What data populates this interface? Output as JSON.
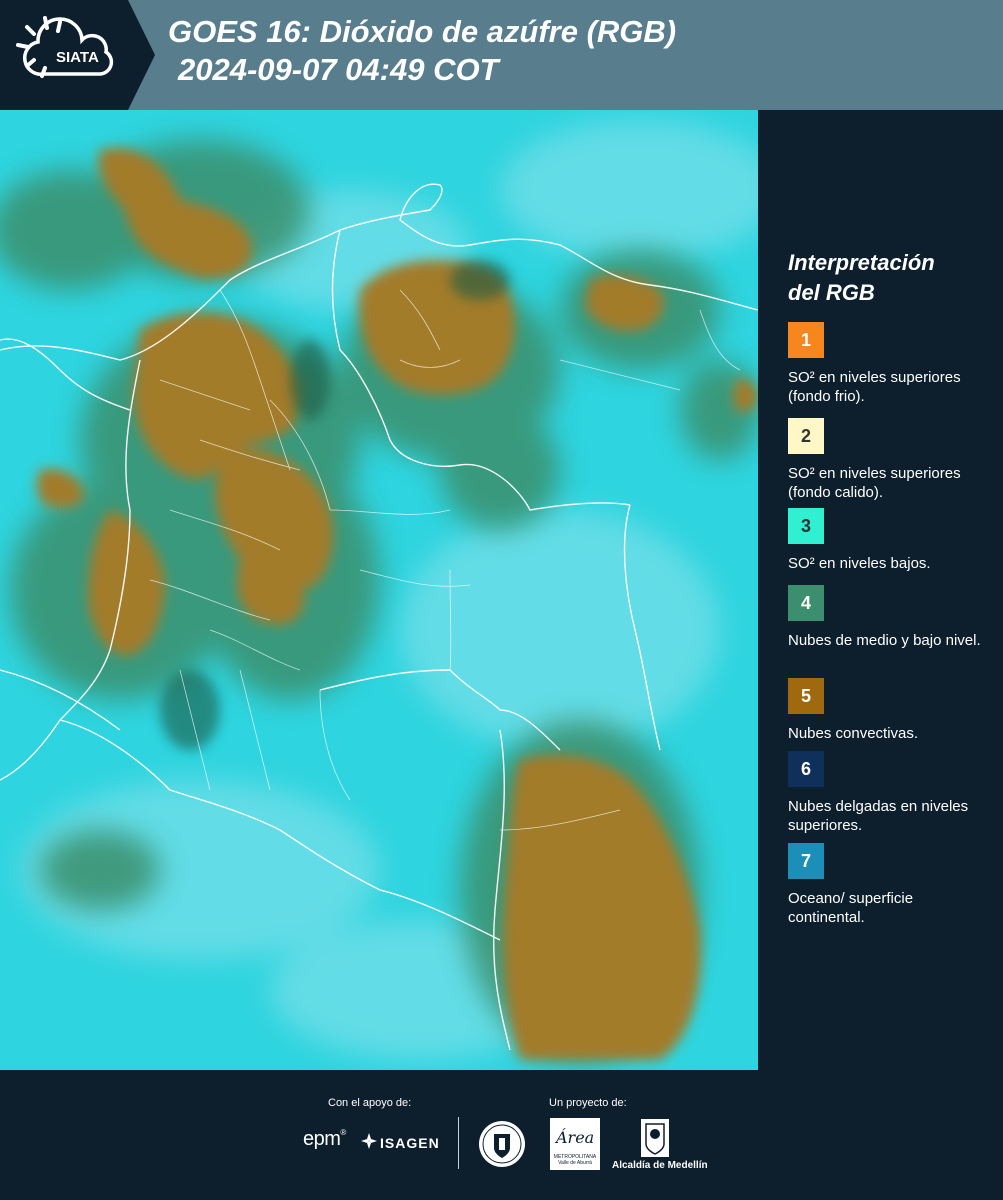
{
  "header": {
    "logo_text": "SIATA",
    "title_line1": "GOES 16: Dióxido de azúfre (RGB)",
    "title_line2": "2024-09-07 04:49 COT",
    "background": "#587d8d"
  },
  "legend": {
    "title_line1": "Interpretación",
    "title_line2": "del RGB",
    "items": [
      {
        "number": "1",
        "color": "#f7861e",
        "text_color": "#ffffff",
        "label": "SO² en niveles superiores (fondo frio)."
      },
      {
        "number": "2",
        "color": "#fff7c6",
        "text_color": "#333333",
        "label": "SO² en niveles superiores (fondo calido)."
      },
      {
        "number": "3",
        "color": "#2ff0d0",
        "text_color": "#333333",
        "label": "SO² en niveles bajos."
      },
      {
        "number": "4",
        "color": "#3c8f6e",
        "text_color": "#ffffff",
        "label": "Nubes de medio y bajo nivel."
      },
      {
        "number": "5",
        "color": "#a0690e",
        "text_color": "#ffffff",
        "label": "Nubes convectivas."
      },
      {
        "number": "6",
        "color": "#10305c",
        "text_color": "#ffffff",
        "label": "Nubes delgadas en niveles superiores."
      },
      {
        "number": "7",
        "color": "#1b8fb8",
        "text_color": "#ffffff",
        "label": "Oceano/ superficie continental."
      }
    ]
  },
  "map": {
    "ocean_color": "#2ed4df",
    "cloud_colors": {
      "convective": "#a07a26",
      "mid_low": "#3f8f6a"
    },
    "border_color": "#ffffff"
  },
  "footer": {
    "support_label": "Con el apoyo de:",
    "project_label": "Un proyecto de:",
    "sponsors": [
      "epm",
      "ISAGEN"
    ],
    "area_logo_word": "Área",
    "area_logo_sub": "METROPOLITANA Valle de Aburrá",
    "medellin_label": "Alcaldía de Medellín"
  }
}
